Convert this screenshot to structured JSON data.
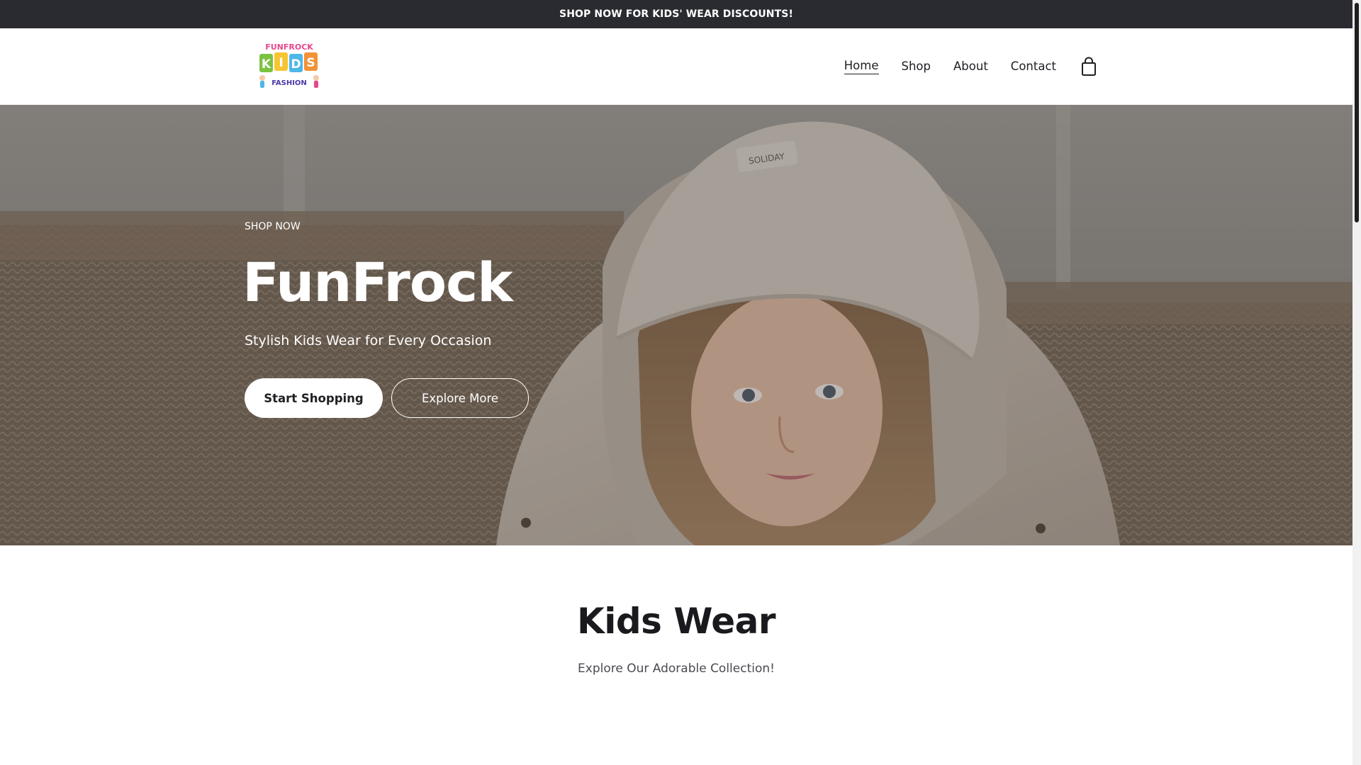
{
  "announcement": {
    "text": "SHOP NOW FOR KIDS' WEAR DISCOUNTS!"
  },
  "header": {
    "logo": {
      "top_text": "FUNFROCK",
      "letters": [
        "K",
        "I",
        "D",
        "S"
      ],
      "bottom_text": "FASHION"
    },
    "nav": {
      "home": "Home",
      "shop": "Shop",
      "about": "About",
      "contact": "Contact"
    },
    "cart_icon": "shopping-bag-icon"
  },
  "hero": {
    "eyebrow": "SHOP NOW",
    "title": "FunFrock",
    "subtitle": "Stylish Kids Wear for Every Occasion",
    "primary_button": "Start Shopping",
    "secondary_button": "Explore More",
    "hat_label": "SOLIDAY"
  },
  "collection": {
    "title": "Kids Wear",
    "subtitle": "Explore Our Adorable Collection!"
  },
  "colors": {
    "announcement_bg": "#2a2b30",
    "text_dark": "#1f1f24",
    "logo_pink": "#e8478b",
    "logo_green": "#7cc242",
    "logo_yellow": "#f7c531",
    "logo_blue": "#4fb7e8",
    "logo_orange": "#f39237"
  }
}
